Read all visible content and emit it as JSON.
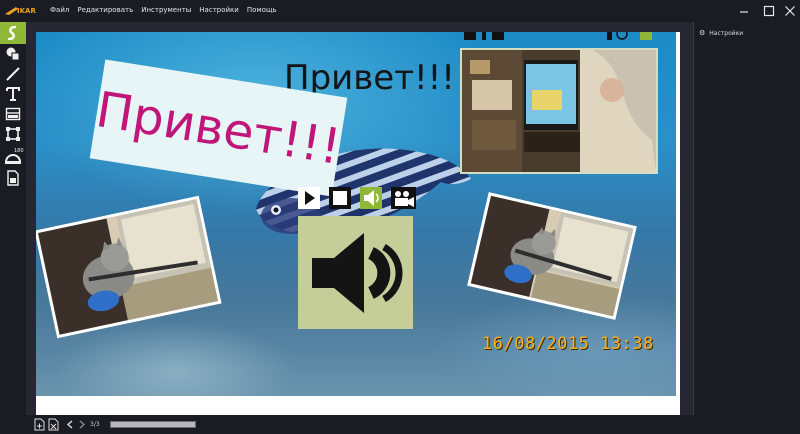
{
  "app": {
    "logo_text": "IKAR",
    "menu": [
      "Файл",
      "Редактировать",
      "Инструменты",
      "Настройки",
      "Помощь"
    ],
    "window_controls": [
      "minimize-icon",
      "maximize-icon",
      "close-icon"
    ]
  },
  "toolbar": {
    "tools": [
      {
        "name": "select-tool-icon",
        "active": true
      },
      {
        "name": "shapes-tool-icon"
      },
      {
        "name": "line-tool-icon"
      },
      {
        "name": "text-tool-icon"
      },
      {
        "name": "layers-tool-icon"
      },
      {
        "name": "frame-tool-icon"
      },
      {
        "name": "rotate-tool-icon",
        "badge": "180"
      },
      {
        "name": "export-tool-icon"
      }
    ],
    "accent": "#8fb838"
  },
  "canvas": {
    "greeting_big": "Привет!!!",
    "greeting_small": "Привет!!!",
    "date_stamp": "16/08/2015  13:38"
  },
  "media_controls": [
    "play-icon",
    "stop-icon",
    "audio-icon",
    "video-camera-icon"
  ],
  "bottombar": {
    "page_count": "3/3",
    "icons": [
      "add-page-icon",
      "delete-page-icon",
      "prev-page-icon",
      "next-page-icon"
    ]
  },
  "rightpanel": {
    "settings_label": "Настройки"
  },
  "colors": {
    "background": "#1b1b24",
    "greeting_big": "#c0167a",
    "date_stamp": "#ffae1a",
    "audio_box": "#c5ce98"
  }
}
